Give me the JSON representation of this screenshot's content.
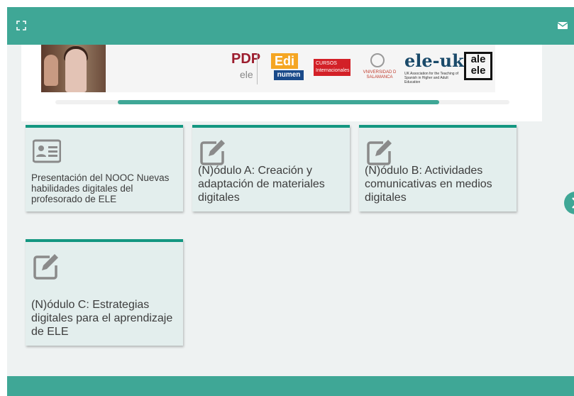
{
  "header": {
    "expand_icon": "expand-icon",
    "mail_icon": "mail-icon"
  },
  "banner": {
    "logos": {
      "pdp": "PDP",
      "pdp_sub": "ele",
      "edi": "Edi",
      "numen": "numen",
      "cursos": "CURSOS Internacionales",
      "usal": "VNIVERSIDAD D SALAMANCA",
      "eleuk": "ele-uk",
      "eleuk_sub": "UK Association for the Teaching of Spanish in Higher and Adult Education",
      "ale": "ale ele"
    },
    "progress": 0.82
  },
  "cards": [
    {
      "title": "Presentación del NOOC Nuevas habilidades digitales del profesorado de ELE",
      "icon": "id-card-icon"
    },
    {
      "title": "(N)ódulo A: Creación y adaptación de materiales digitales",
      "icon": "edit-icon"
    },
    {
      "title": "(N)ódulo B: Actividades comunicativas en medios digitales",
      "icon": "edit-icon"
    },
    {
      "title": "(N)ódulo C: Estrategias digitales para el aprendizaje de ELE",
      "icon": "edit-icon"
    }
  ],
  "navigation": {
    "next_icon": "chevron-right-icon"
  },
  "colors": {
    "accent": "#3fa796",
    "card_border": "#139781",
    "card_bg": "#e3eeed",
    "card_text": "#3d3d3d",
    "icon": "#8a8a8a"
  }
}
